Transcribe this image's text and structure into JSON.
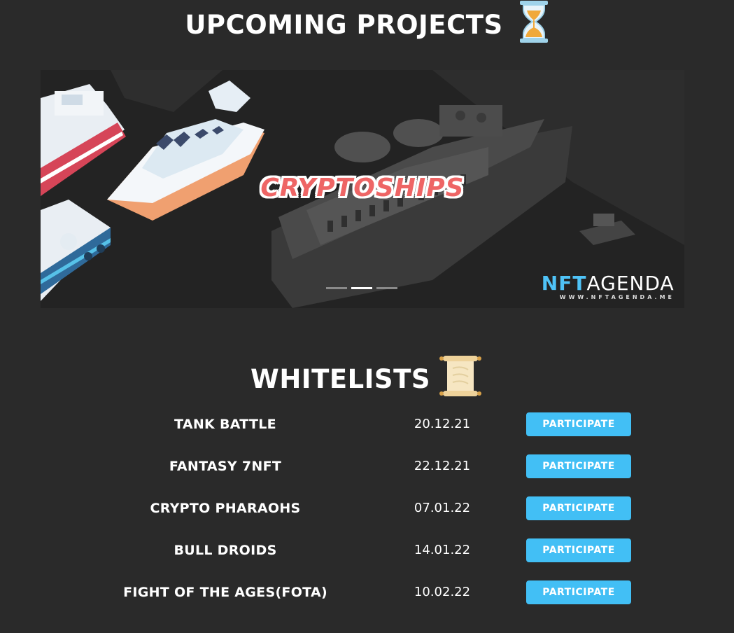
{
  "upcoming": {
    "title": "UPCOMING PROJECTS",
    "icon": "hourglass-icon"
  },
  "banner": {
    "title": "CRYPTOSHIPS",
    "logo_brand_a": "NFT",
    "logo_brand_b": "AGENDA",
    "logo_url": "WWW.NFTAGENDA.ME",
    "slides": 3,
    "active_slide": 2
  },
  "whitelists": {
    "title": "WHITELISTS",
    "icon": "scroll-icon",
    "rows": [
      {
        "name": "TANK BATTLE",
        "date": "20.12.21",
        "button": "PARTICIPATE"
      },
      {
        "name": "FANTASY 7NFT",
        "date": "22.12.21",
        "button": "PARTICIPATE"
      },
      {
        "name": "CRYPTO PHARAOHS",
        "date": "07.01.22",
        "button": "PARTICIPATE"
      },
      {
        "name": "BULL DROIDS",
        "date": "14.01.22",
        "button": "PARTICIPATE"
      },
      {
        "name": "FIGHT OF THE AGES(FOTA)",
        "date": "10.02.22",
        "button": "PARTICIPATE"
      }
    ]
  },
  "colors": {
    "background": "#2a2a2a",
    "accent": "#42bff5",
    "banner_title": "#ee6565"
  }
}
